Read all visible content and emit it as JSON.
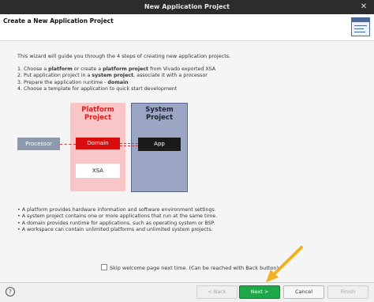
{
  "window": {
    "title": "New Application Project"
  },
  "header": {
    "title": "Create a New Application Project"
  },
  "intro": "This wizard will guide you through the 4 steps of creating new application projects.",
  "steps": [
    {
      "pre": "1.  Choose a ",
      "bold": "platform",
      "mid": " or create a ",
      "bold2": "platform project",
      "post": " from Vivado exported XSA"
    },
    {
      "pre": "2.  Put application project in a ",
      "bold": "system project",
      "mid": ", associate it with a processor",
      "bold2": "",
      "post": ""
    },
    {
      "pre": "3.  Prepare the application runtime - ",
      "bold": "domain",
      "mid": "",
      "bold2": "",
      "post": ""
    },
    {
      "pre": "4.  Choose a template for application to quick start development",
      "bold": "",
      "mid": "",
      "bold2": "",
      "post": ""
    }
  ],
  "diagram": {
    "platform_title_line1": "Platform",
    "platform_title_line2": "Project",
    "system_title_line1": "System",
    "system_title_line2": "Project",
    "processor": "Processor",
    "domain": "Domain",
    "xsa": "XSA",
    "app": "App"
  },
  "bullets": [
    "• A platform provides hardware information and software environment settings.",
    "• A system project contains one or more applications that run at the same time.",
    "• A domain provides runtime for applications, such as operating system or BSP.",
    "• A workspace can contain unlimited platforms and unlimited system projects."
  ],
  "skip_label": "Skip welcome page next time. (Can be reached with Back button)",
  "footer": {
    "help": "?",
    "back": "< Back",
    "next": "Next >",
    "cancel": "Cancel",
    "finish": "Finish"
  },
  "colors": {
    "primary_button": "#1ea84a",
    "arrow": "#f0b020",
    "domain": "#d90d0d",
    "platform_bg": "#f8c6c6"
  }
}
